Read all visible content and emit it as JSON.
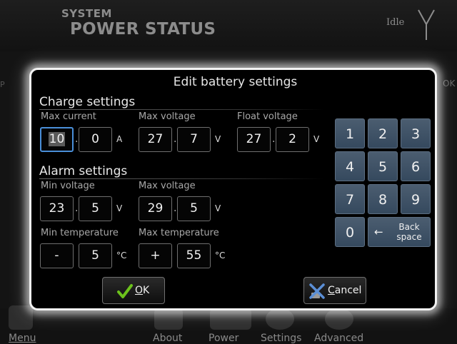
{
  "header": {
    "system_label": "SYSTEM",
    "title": "POWER STATUS",
    "status": "Idle",
    "antenna_icon": "antenna-icon",
    "edge_left": "P",
    "edge_right": "OK"
  },
  "bottom_nav": {
    "menu": "Menu",
    "about": "About",
    "power": "Power",
    "settings": "Settings",
    "advanced": "Advanced"
  },
  "dialog": {
    "title": "Edit battery settings",
    "charge": {
      "section_title": "Charge settings",
      "max_current": {
        "label": "Max current",
        "int": "10",
        "dec": "0",
        "unit": "A"
      },
      "max_voltage": {
        "label": "Max voltage",
        "int": "27",
        "dec": "7",
        "unit": "V"
      },
      "float_voltage": {
        "label": "Float voltage",
        "int": "27",
        "dec": "2",
        "unit": "V"
      }
    },
    "alarm": {
      "section_title": "Alarm settings",
      "min_voltage": {
        "label": "Min voltage",
        "int": "23",
        "dec": "5",
        "unit": "V"
      },
      "max_voltage": {
        "label": "Max voltage",
        "int": "29",
        "dec": "5",
        "unit": "V"
      },
      "min_temperature": {
        "label": "Min temperature",
        "sign": "-",
        "value": "5",
        "unit": "°C"
      },
      "max_temperature": {
        "label": "Max temperature",
        "sign": "+",
        "value": "55",
        "unit": "°C"
      }
    },
    "decimal_separator": ".",
    "keypad": {
      "keys": [
        "1",
        "2",
        "3",
        "4",
        "5",
        "6",
        "7",
        "8",
        "9",
        "0"
      ],
      "backspace_line1": "Back",
      "backspace_line2": "space",
      "backspace_icon": "left-arrow-icon"
    },
    "ok": {
      "accel": "O",
      "rest": "K",
      "icon": "checkmark-icon"
    },
    "cancel": {
      "accel": "C",
      "rest": "ancel",
      "icon": "cross-icon"
    }
  },
  "colors": {
    "dialog_border": "#f2f2f2",
    "key_fill": "#3f5367",
    "selection": "#4a8fd9",
    "ok_check": "#6cc21c",
    "cancel_cross": "#5b8fd6"
  }
}
